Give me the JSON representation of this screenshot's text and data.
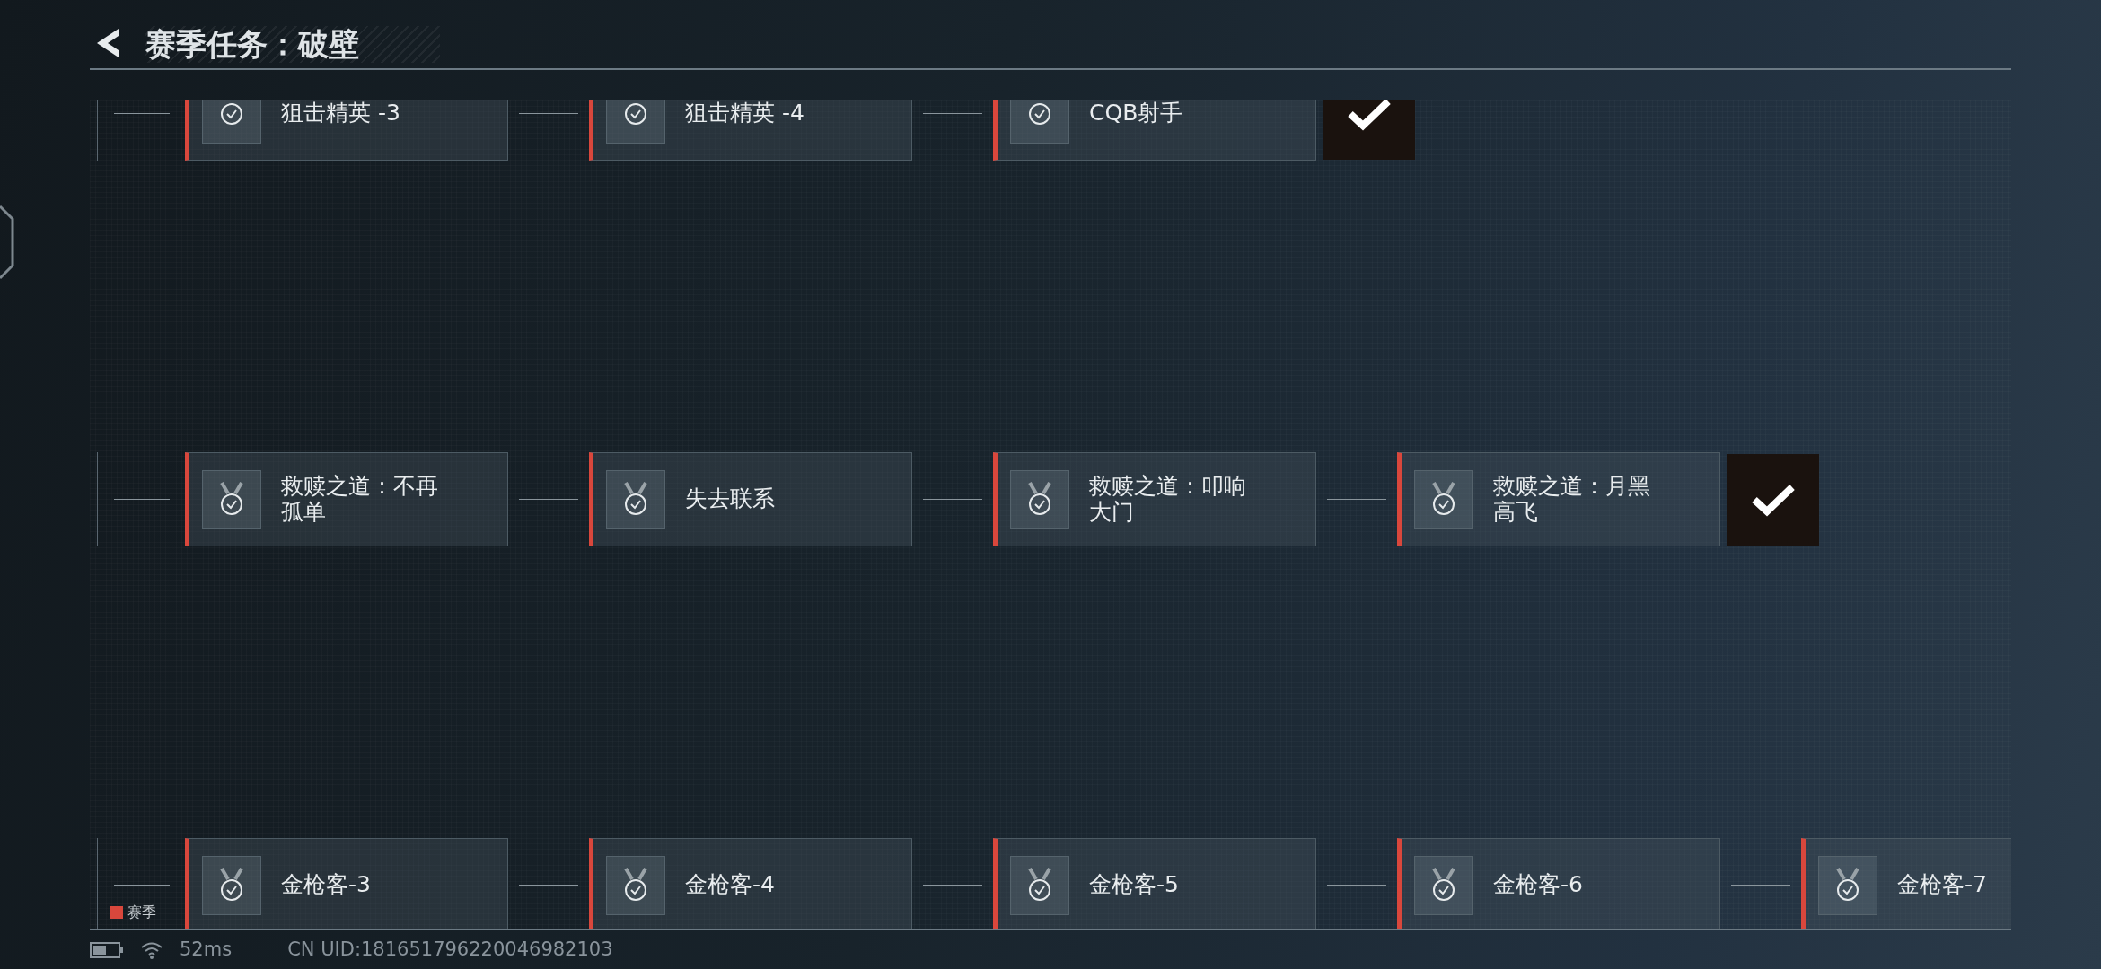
{
  "header": {
    "title": "赛季任务：破壁"
  },
  "rows": [
    {
      "cards": [
        {
          "kind": "check",
          "title": "狙击精英 -3"
        },
        {
          "kind": "check",
          "title": "狙击精英 -4"
        },
        {
          "kind": "check",
          "title": "CQB射手"
        }
      ],
      "completed": true
    },
    {
      "cards": [
        {
          "kind": "medal",
          "title": "救赎之道：不再孤单"
        },
        {
          "kind": "medal",
          "title": "失去联系"
        },
        {
          "kind": "medal",
          "title": "救赎之道：叩响大门"
        },
        {
          "kind": "medal",
          "title": "救赎之道：月黑高飞"
        }
      ],
      "completed": true
    },
    {
      "cards": [
        {
          "kind": "medal",
          "title": "金枪客-3"
        },
        {
          "kind": "medal",
          "title": "金枪客-4"
        },
        {
          "kind": "medal",
          "title": "金枪客-5"
        },
        {
          "kind": "medal",
          "title": "金枪客-6"
        },
        {
          "kind": "medal",
          "title": "金枪客-7"
        }
      ],
      "completed": false
    }
  ],
  "legend": {
    "label": "赛季",
    "color": "#d9473c"
  },
  "status": {
    "ping": "52ms",
    "uid": "CN UID:181651796220046982103"
  }
}
